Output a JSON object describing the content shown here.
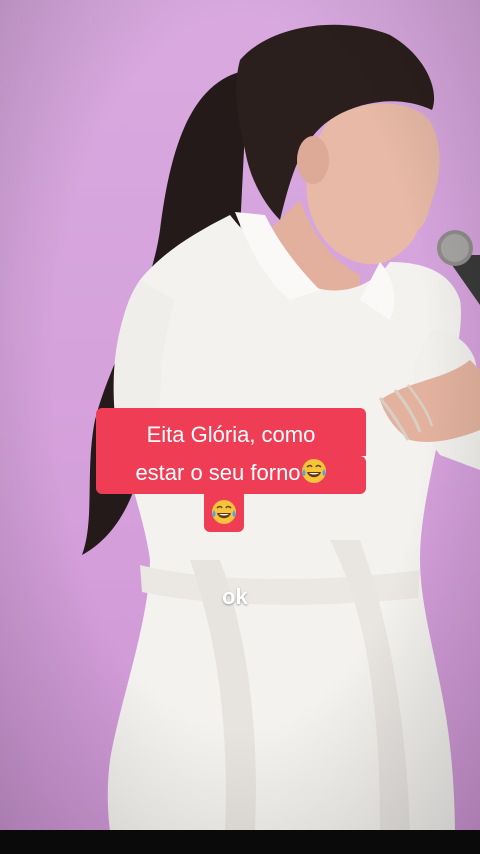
{
  "video": {
    "caption_line1": "Eita Glória, como",
    "caption_line2": "estar o seu forno",
    "caption_emoji_1": "face-with-tears-of-joy-icon",
    "caption_emoji_2": "face-with-tears-of-joy-icon",
    "overlay_text": "ok"
  },
  "colors": {
    "background": "#d8a9df",
    "caption_bg": "#ee3d54",
    "caption_text": "#ffffff",
    "dress": "#f3f1ef",
    "hair": "#2a1e1c",
    "skin": "#e6b7a4"
  }
}
